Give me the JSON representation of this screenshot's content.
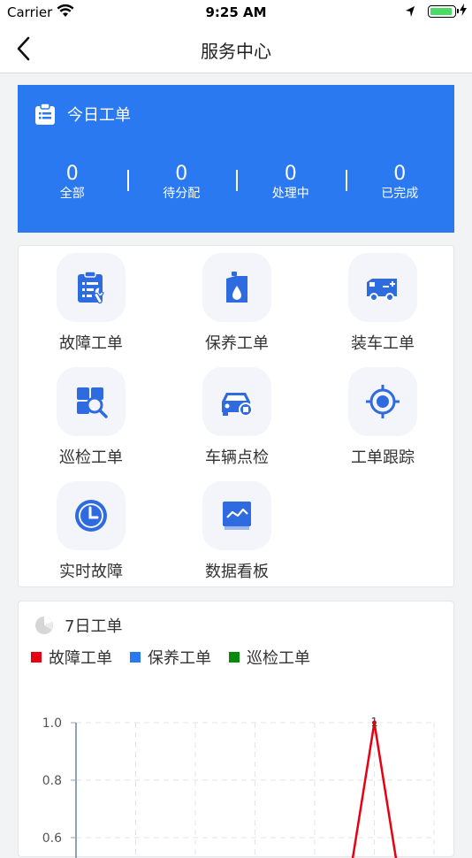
{
  "status_bar": {
    "carrier": "Carrier",
    "time": "9:25 AM"
  },
  "nav": {
    "title": "服务中心"
  },
  "today": {
    "title": "今日工单",
    "stats": [
      {
        "value": "0",
        "label": "全部"
      },
      {
        "value": "0",
        "label": "待分配"
      },
      {
        "value": "0",
        "label": "处理中"
      },
      {
        "value": "0",
        "label": "已完成"
      }
    ]
  },
  "menu": {
    "items": [
      {
        "label": "故障工单",
        "icon": "clipboard-wrench-icon"
      },
      {
        "label": "保养工单",
        "icon": "oil-can-icon"
      },
      {
        "label": "装车工单",
        "icon": "truck-icon"
      },
      {
        "label": "巡检工单",
        "icon": "inspect-search-icon"
      },
      {
        "label": "车辆点检",
        "icon": "car-check-icon"
      },
      {
        "label": "工单跟踪",
        "icon": "target-icon"
      },
      {
        "label": "实时故障",
        "icon": "clock-icon"
      },
      {
        "label": "数据看板",
        "icon": "dashboard-monitor-icon"
      }
    ]
  },
  "weekly": {
    "title": "7日工单",
    "legend": [
      {
        "label": "故障工单",
        "color": "#e60012"
      },
      {
        "label": "保养工单",
        "color": "#2b79f0"
      },
      {
        "label": "巡检工单",
        "color": "#0a8a0a"
      }
    ]
  },
  "chart_data": {
    "type": "line",
    "title": "7日工单",
    "series": [
      {
        "name": "故障工单",
        "color": "#e60012",
        "values": [
          null,
          null,
          null,
          null,
          null,
          1,
          null
        ]
      }
    ],
    "y_ticks": [
      "1.0",
      "0.8",
      "0.6"
    ],
    "ylim": [
      0,
      1.0
    ],
    "data_labels": [
      "1"
    ],
    "grid": true,
    "legend_position": "top-left"
  },
  "colors": {
    "primary": "#2b79f0",
    "icon_blue": "#2f6be0"
  }
}
